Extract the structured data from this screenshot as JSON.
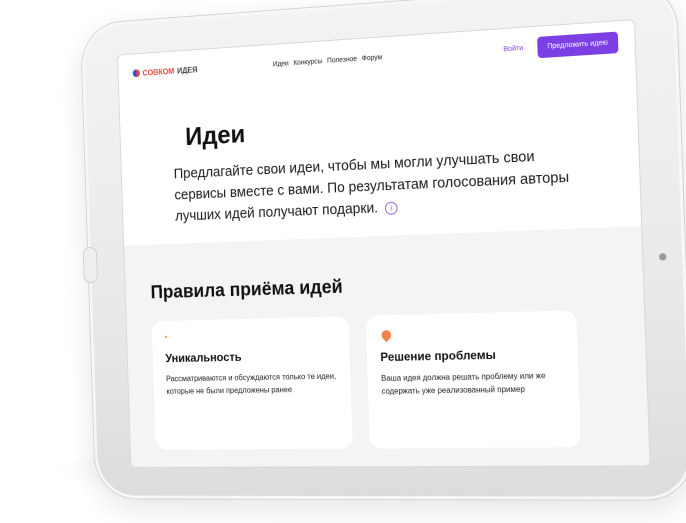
{
  "header": {
    "logo_part1": "СОВКОМ",
    "logo_part2": "ИДЕЯ",
    "nav": [
      "Идеи",
      "Конкурсы",
      "Полезное",
      "Форум"
    ],
    "login": "Войти",
    "propose": "Предложить идею"
  },
  "hero": {
    "title": "Идеи",
    "text": "Предлагайте свои идеи, чтобы мы могли улучшать свои сервисы вместе с вами. По результатам голосования авторы лучших идей получают подарки."
  },
  "rules": {
    "title": "Правила приёма идей",
    "cards": [
      {
        "title": "Уникальность",
        "text": "Рассматриваются и обсуждаются только те идеи, которые не были предложены ранее",
        "icon": "sparkle-icon"
      },
      {
        "title": "Решение проблемы",
        "text": "Ваша идея должна решать проблему или же содержать уже реализованный пример",
        "icon": "location-pin-icon"
      }
    ]
  },
  "colors": {
    "accent": "#7b3fe4",
    "brand_red": "#e04c3a",
    "brand_blue": "#2b56d8",
    "icon_orange": "#f1824a"
  }
}
